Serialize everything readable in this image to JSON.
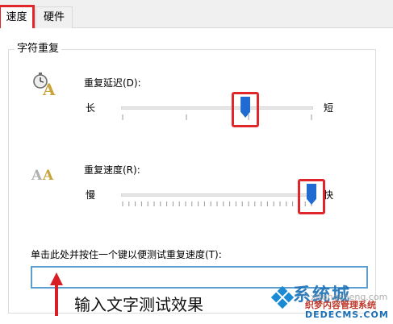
{
  "tabs": [
    {
      "label": "速度",
      "active": true
    },
    {
      "label": "硬件",
      "active": false
    }
  ],
  "group": {
    "title": "字符重复"
  },
  "repeat_delay": {
    "label": "重复延迟(D):",
    "left_label": "长",
    "right_label": "短",
    "value": 0.65,
    "icon": "stopwatch-letter-a-icon"
  },
  "repeat_rate": {
    "label": "重复速度(R):",
    "left_label": "慢",
    "right_label": "快",
    "value": 1.0,
    "icon": "double-letter-a-icon"
  },
  "test": {
    "label": "单击此处并按住一个键以便测试重复速度(T):",
    "value": ""
  },
  "annotation": {
    "text": "输入文字测试效果"
  },
  "watermark": {
    "brand": "系统城",
    "site": "xitongcheng.com",
    "tagline": "织梦内容管理系统",
    "domain": "DEDECMS.COM"
  },
  "colors": {
    "highlight": "#e0262b",
    "thumb": "#1f6bd1",
    "input_border": "#5a9fcf"
  }
}
